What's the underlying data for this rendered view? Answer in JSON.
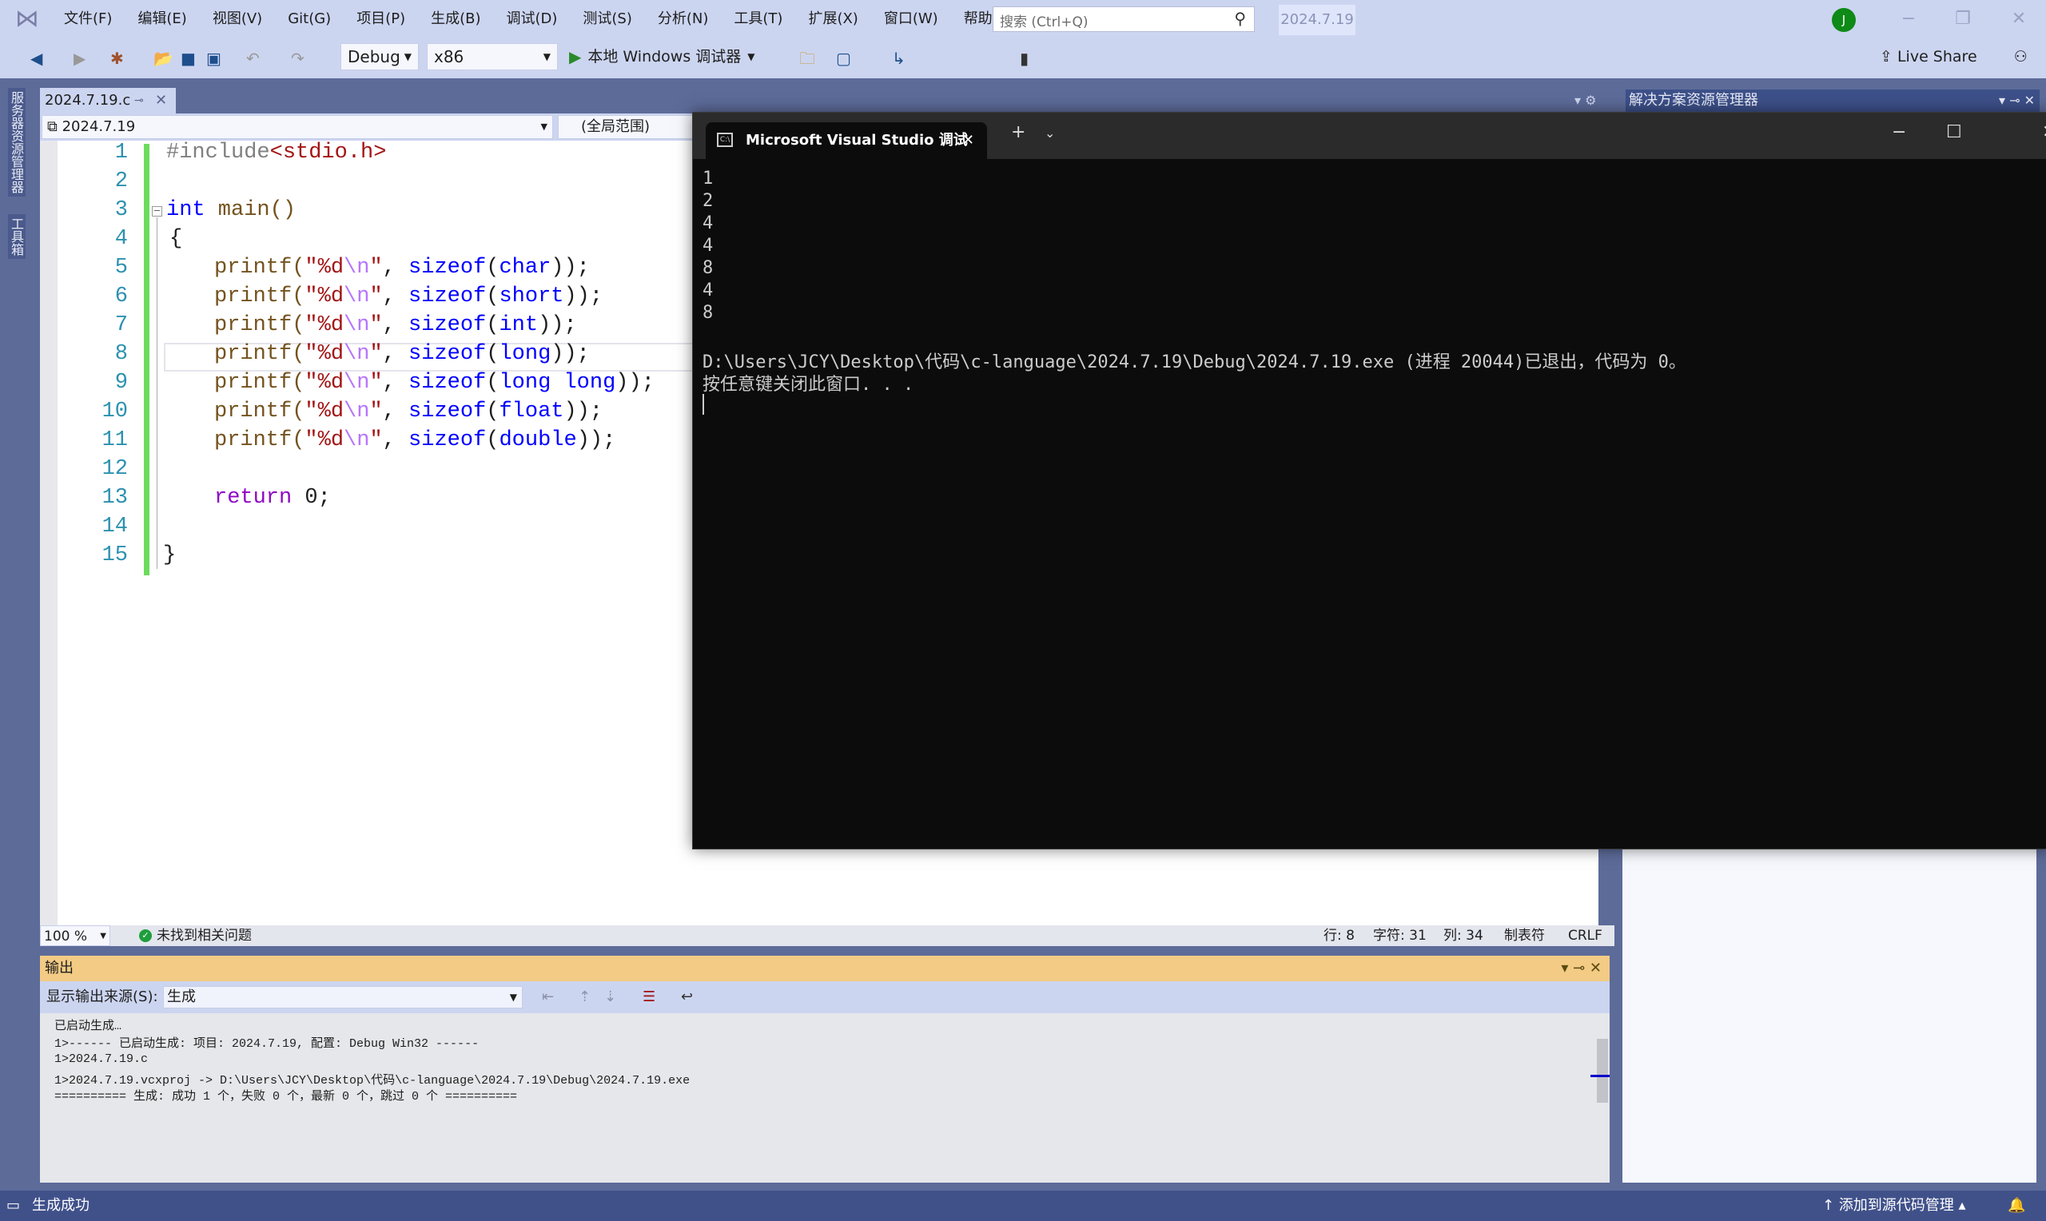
{
  "menubar": {
    "items": [
      "文件(F)",
      "编辑(E)",
      "视图(V)",
      "Git(G)",
      "项目(P)",
      "生成(B)",
      "调试(D)",
      "测试(S)",
      "分析(N)",
      "工具(T)",
      "扩展(X)",
      "窗口(W)",
      "帮助(H)"
    ],
    "search_placeholder": "搜索 (Ctrl+Q)",
    "solution_name": "2024.7.19",
    "avatar_initial": "J"
  },
  "toolbar": {
    "configuration": "Debug",
    "platform": "x86",
    "run_label": "本地 Windows 调试器",
    "live_share": "Live Share"
  },
  "side_tabs": [
    "服务器资源管理器",
    "工具箱"
  ],
  "editor": {
    "tab_title": "2024.7.19.c",
    "nav_project": "2024.7.19",
    "nav_scope": "(全局范围)",
    "line_numbers": [
      "1",
      "2",
      "3",
      "4",
      "5",
      "6",
      "7",
      "8",
      "9",
      "10",
      "11",
      "12",
      "13",
      "14",
      "15"
    ],
    "code": {
      "l1_directive": "#include",
      "l1_header": "<stdio.h>",
      "l3_type": "int",
      "l3_name": " main()",
      "l4": "{",
      "printf": "printf(",
      "fmt_a": "\"%d",
      "fmt_esc": "\\n",
      "fmt_b": "\"",
      "comma": ", ",
      "sizeof": "sizeof",
      "types": [
        "char",
        "short",
        "int",
        "long",
        "long long",
        "float",
        "double"
      ],
      "close": "));",
      "return_kw": "return",
      "return_val": " 0;",
      "l15": "}"
    },
    "zoom": "100 %",
    "issues": "未找到相关问题",
    "row": "行: 8",
    "char": "字符: 31",
    "col": "列: 34",
    "indent": "制表符",
    "eol": "CRLF"
  },
  "console": {
    "tab_title": "Microsoft Visual Studio 调试",
    "output_lines": [
      "1",
      "2",
      "4",
      "4",
      "8",
      "4",
      "8",
      "",
      "D:\\Users\\JCY\\Desktop\\代码\\c-language\\2024.7.19\\Debug\\2024.7.19.exe (进程 20044)已退出，代码为 0。",
      "按任意键关闭此窗口. . ."
    ]
  },
  "output_panel": {
    "title": "输出",
    "source_label": "显示输出来源(S):",
    "source_value": "生成",
    "lines": [
      "已启动生成…",
      "1>------ 已启动生成: 项目: 2024.7.19, 配置: Debug Win32 ------",
      "1>2024.7.19.c",
      "1>2024.7.19.vcxproj -> D:\\Users\\JCY\\Desktop\\代码\\c-language\\2024.7.19\\Debug\\2024.7.19.exe",
      "========== 生成: 成功 1 个，失败 0 个，最新 0 个，跳过 0 个 =========="
    ]
  },
  "solution_explorer": {
    "title": "解决方案资源管理器"
  },
  "statusbar": {
    "message": "生成成功",
    "source_control": "添加到源代码管理"
  }
}
